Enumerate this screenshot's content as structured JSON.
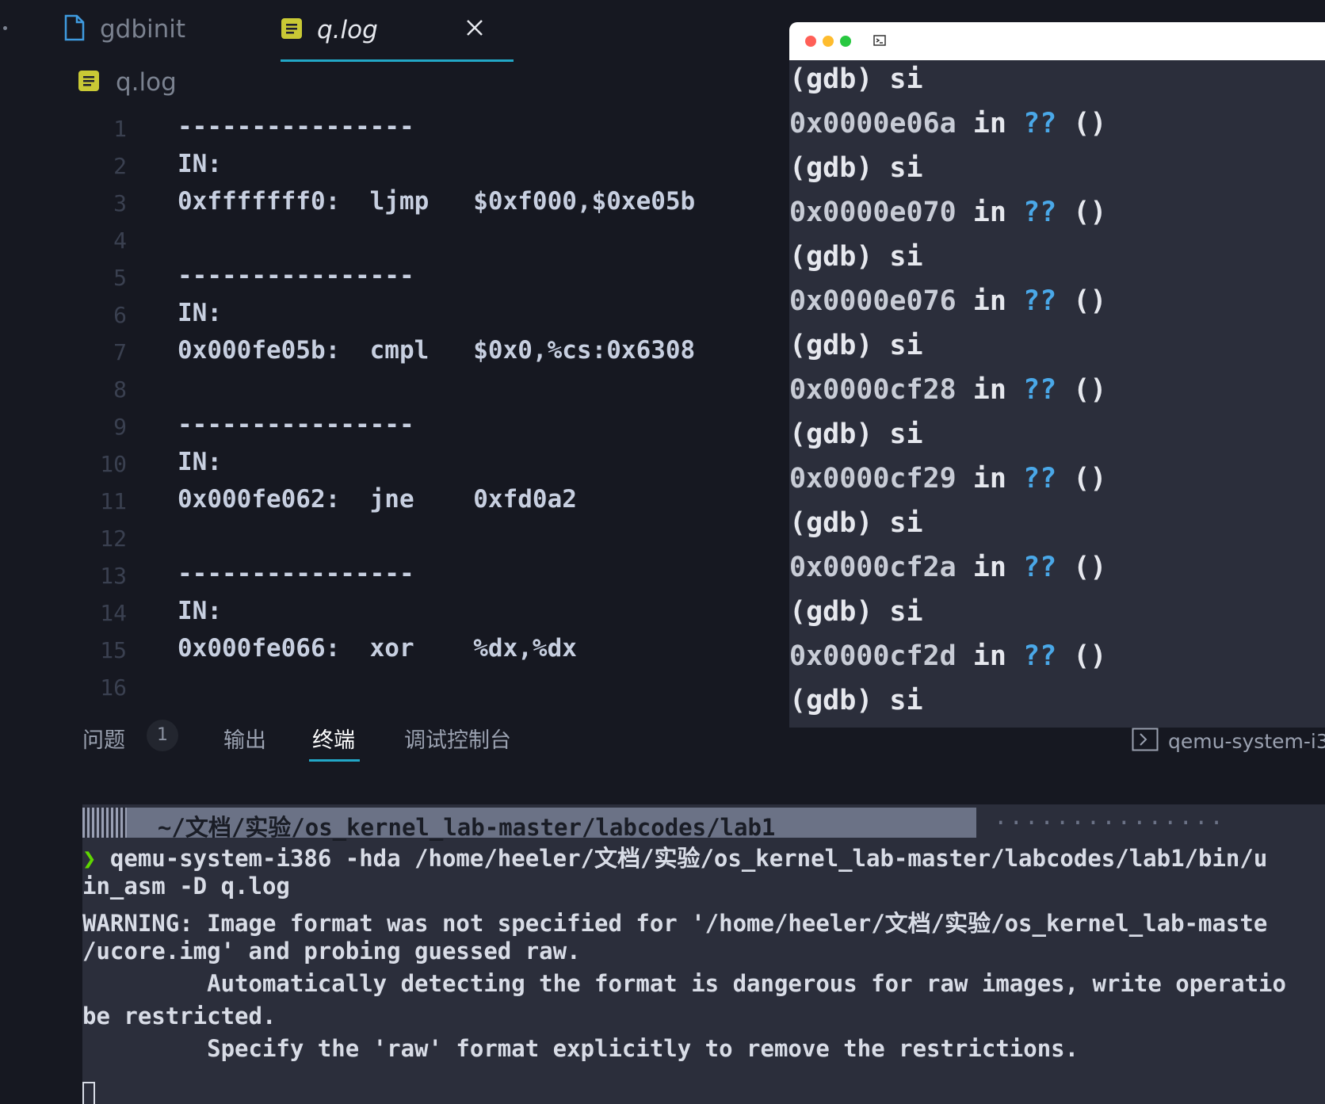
{
  "editor": {
    "tabs": [
      {
        "label": "gdbinit"
      },
      {
        "label": "q.log"
      }
    ],
    "breadcrumb": "q.log",
    "lines": [
      {
        "num": "1",
        "text": "----------------"
      },
      {
        "num": "2",
        "text": "IN:"
      },
      {
        "num": "3",
        "text": "0xfffffff0:  ljmp   $0xf000,$0xe05b"
      },
      {
        "num": "4",
        "text": ""
      },
      {
        "num": "5",
        "text": "----------------"
      },
      {
        "num": "6",
        "text": "IN:"
      },
      {
        "num": "7",
        "text": "0x000fe05b:  cmpl   $0x0,%cs:0x6308"
      },
      {
        "num": "8",
        "text": ""
      },
      {
        "num": "9",
        "text": "----------------"
      },
      {
        "num": "10",
        "text": "IN:"
      },
      {
        "num": "11",
        "text": "0x000fe062:  jne    0xfd0a2"
      },
      {
        "num": "12",
        "text": ""
      },
      {
        "num": "13",
        "text": "----------------"
      },
      {
        "num": "14",
        "text": "IN:"
      },
      {
        "num": "15",
        "text": "0x000fe066:  xor    %dx,%dx"
      },
      {
        "num": "16",
        "text": ""
      }
    ]
  },
  "panel": {
    "tabs": [
      {
        "label": "问题"
      },
      {
        "label": "输出"
      },
      {
        "label": "终端"
      },
      {
        "label": "调试控制台"
      }
    ],
    "problems_count": "1",
    "terminal_selector": "qemu-system-i3"
  },
  "terminal": {
    "prompt_path": "  ~/文档/实验/os_kernel_lab-master/labcodes/lab1 ",
    "prompt_dots": "···············",
    "prompt_arrow": "❯",
    "command_line": " qemu-system-i386 -hda /home/heeler/文档/实验/os_kernel_lab-master/labcodes/lab1/bin/u",
    "lines": [
      "in_asm -D q.log",
      "WARNING: Image format was not specified for '/home/heeler/文档/实验/os_kernel_lab-maste",
      "/ucore.img' and probing guessed raw.",
      "         Automatically detecting the format is dangerous for raw images, write operatio",
      "be restricted.",
      "         Specify the 'raw' format explicitly to remove the restrictions."
    ]
  },
  "gdb": {
    "prompt": "(gdb) si",
    "entries": [
      {
        "addr": "0x0000e06a",
        "in": " in ",
        "qm": "??",
        "parens": " ()"
      },
      {
        "addr": "0x0000e070",
        "in": " in ",
        "qm": "??",
        "parens": " ()"
      },
      {
        "addr": "0x0000e076",
        "in": " in ",
        "qm": "??",
        "parens": " ()"
      },
      {
        "addr": "0x0000cf28",
        "in": " in ",
        "qm": "??",
        "parens": " ()"
      },
      {
        "addr": "0x0000cf29",
        "in": " in ",
        "qm": "??",
        "parens": " ()"
      },
      {
        "addr": "0x0000cf2a",
        "in": " in ",
        "qm": "??",
        "parens": " ()"
      },
      {
        "addr": "0x0000cf2d",
        "in": " in ",
        "qm": "??",
        "parens": " ()"
      }
    ]
  },
  "colors": {
    "background": "#161821",
    "accent": "#22a7c7",
    "terminal_bg": "#2b2e3b",
    "gdb_question": "#4aa8e8",
    "prompt_arrow": "#5fd700"
  }
}
